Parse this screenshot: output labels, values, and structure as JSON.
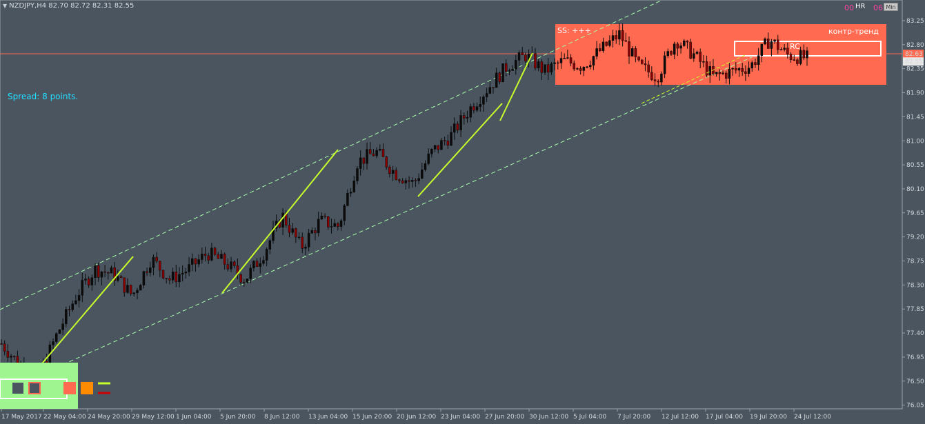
{
  "header": {
    "symbol_text": "NZDJPY,H4  82.70 82.72 82.31 82.55"
  },
  "spread_text": "Spread: 8 points.",
  "zone_labels": {
    "ss": "SS: +++",
    "counter_trend": "контр-тренд",
    "rc": "RC"
  },
  "top_right": {
    "hr_num": "00",
    "hr_label": "HR",
    "min_num": "06",
    "min_button": "Min"
  },
  "price_axis": {
    "labels": [
      "83.25",
      "82.80",
      "82.35",
      "81.90",
      "81.45",
      "81.00",
      "80.55",
      "80.10",
      "79.65",
      "79.20",
      "78.75",
      "78.30",
      "77.85",
      "77.40",
      "76.95",
      "76.50",
      "76.05"
    ],
    "current_price": "82.55",
    "ask_price": "82.63"
  },
  "time_axis": {
    "labels": [
      "17 May 2017",
      "22 May 04:00",
      "24 May 20:00",
      "29 May 12:00",
      "1 Jun 04:00",
      "5 Jun 20:00",
      "8 Jun 12:00",
      "13 Jun 04:00",
      "15 Jun 20:00",
      "20 Jun 12:00",
      "23 Jun 04:00",
      "27 Jun 20:00",
      "30 Jun 12:00",
      "5 Jul 04:00",
      "7 Jul 20:00",
      "12 Jul 12:00",
      "17 Jul 04:00",
      "19 Jul 20:00",
      "24 Jul 12:00"
    ]
  },
  "colors": {
    "background": "#4a5560",
    "bull_candle": "#0b0b0b",
    "bear_candle": "#8b0000",
    "zone": "#ff6a50",
    "legend_zone": "#9ff58f",
    "trend_line": "#c8ff2a",
    "channel_line": "#aaffaa",
    "horizontal_line": "#ff6a50",
    "spread_text": "#20e0ff"
  },
  "chart_data": {
    "type": "candlestick",
    "y_range": [
      76.05,
      83.25
    ],
    "x_labels": [
      "17 May 2017",
      "22 May 04:00",
      "24 May 20:00",
      "29 May 12:00",
      "1 Jun 04:00",
      "5 Jun 20:00",
      "8 Jun 12:00",
      "13 Jun 04:00",
      "15 Jun 20:00",
      "20 Jun 12:00",
      "23 Jun 04:00",
      "27 Jun 20:00",
      "30 Jun 12:00",
      "5 Jul 04:00",
      "7 Jul 20:00",
      "12 Jul 12:00",
      "17 Jul 04:00",
      "19 Jul 20:00",
      "24 Jul 12:00"
    ],
    "close_path": [
      77.2,
      76.8,
      76.6,
      77.4,
      78.1,
      78.6,
      78.5,
      78.1,
      78.8,
      78.4,
      78.6,
      78.9,
      78.7,
      78.4,
      78.9,
      79.6,
      79.0,
      79.5,
      79.4,
      80.6,
      80.8,
      80.4,
      80.2,
      80.8,
      81.1,
      81.6,
      82.0,
      82.4,
      82.6,
      82.3,
      82.5,
      82.4,
      82.7,
      83.0,
      82.4,
      82.2,
      82.9,
      82.6,
      82.2,
      82.3,
      82.4,
      82.9,
      82.6,
      82.55
    ],
    "last_price": 82.55
  }
}
